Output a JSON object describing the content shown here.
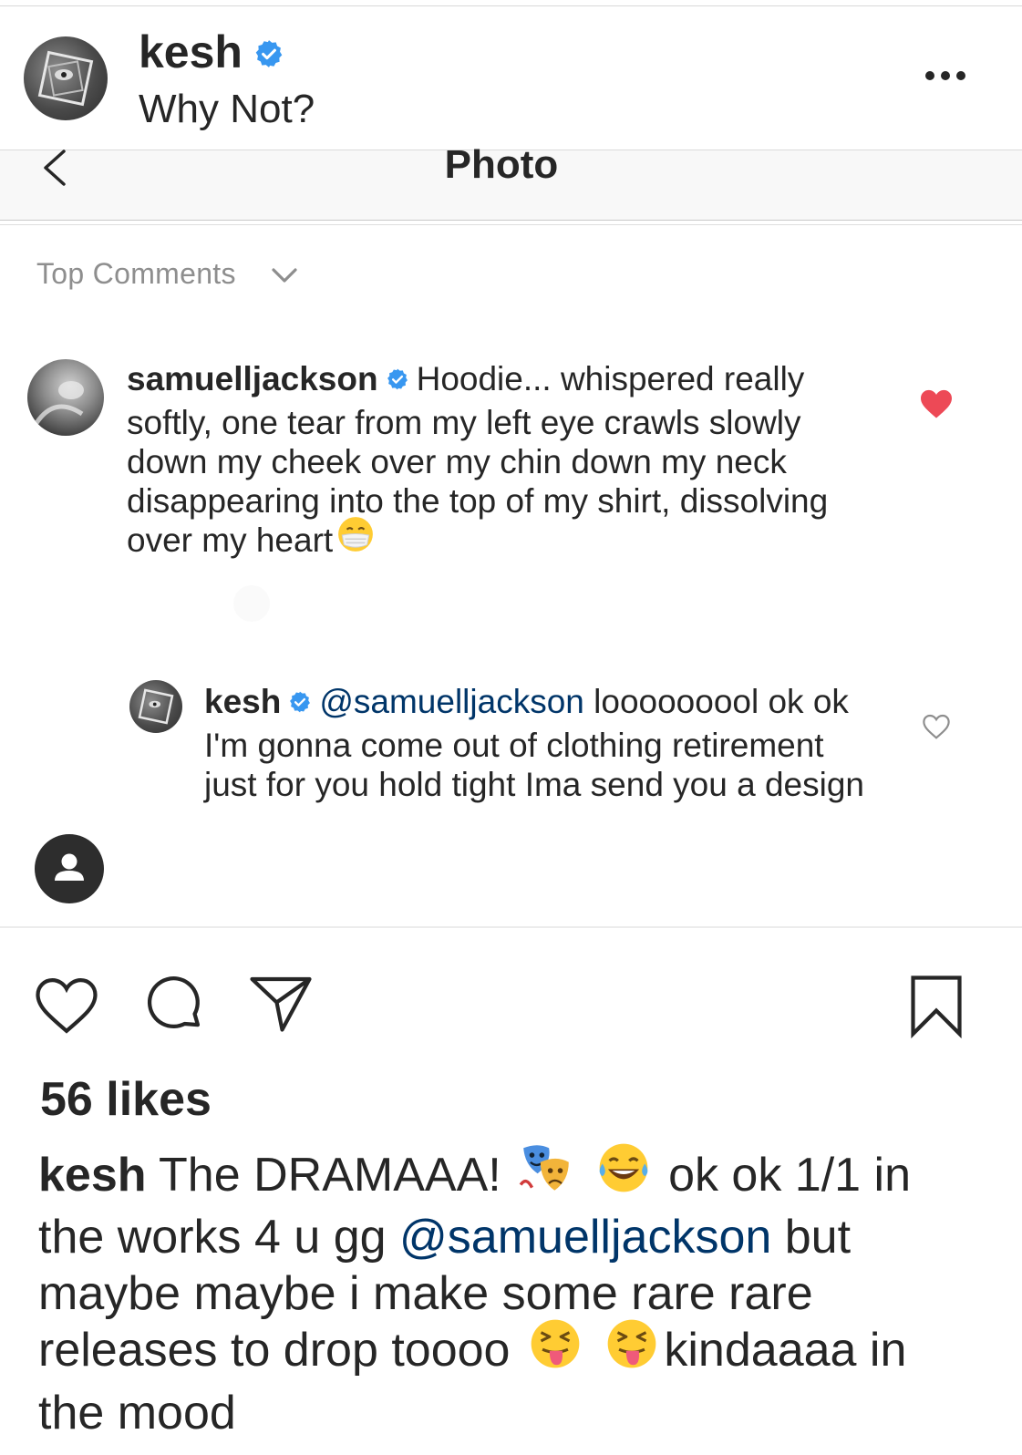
{
  "post_header": {
    "username": "kesh",
    "location": "Why Not?"
  },
  "photo_nav": {
    "title": "Photo"
  },
  "comments_section": {
    "sort_label": "Top Comments"
  },
  "comments": [
    {
      "username": "samuelljackson",
      "text": "Hoodie... whispered really softly, one tear from my left eye crawls slowly down my cheek over my chin down my neck disappearing into the top of my shirt, dissolving over my heart",
      "liked": true
    },
    {
      "username": "kesh",
      "mention": "@samuelljackson",
      "text": "looooooool ok ok I'm gonna come out of clothing retirement just for you hold tight Ima send you a design",
      "liked": false
    }
  ],
  "post_footer": {
    "likes": "56 likes",
    "caption": {
      "username": "kesh",
      "text1": "The DRAMAAA!",
      "text2": "ok ok 1/1 in the works 4 u gg",
      "mention": "@samuelljackson",
      "text3": "but maybe maybe i make some rare rare releases to drop toooo",
      "text4": "kindaaaa in the mood"
    }
  },
  "colors": {
    "text": "#262626",
    "secondary": "#8e8e8e",
    "verified": "#3897f0",
    "like_red": "#ed4956",
    "mention": "#003569"
  },
  "icons": [
    "verified-badge-icon",
    "more-options-icon",
    "back-chevron-icon",
    "chevron-down-icon",
    "heart-icon",
    "comment-icon",
    "share-icon",
    "bookmark-icon",
    "person-icon",
    "performing-arts-emoji",
    "tears-of-joy-emoji",
    "squinting-tongue-emoji",
    "medical-mask-emoji"
  ]
}
